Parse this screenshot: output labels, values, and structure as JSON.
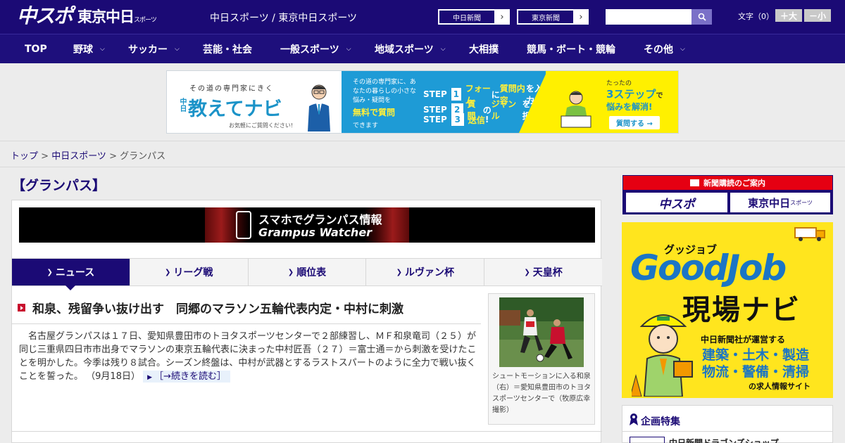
{
  "header": {
    "logo_chusupo": "中スポ",
    "logo_tokyo": "東京中日",
    "logo_tokyo_small": "スポーツ",
    "site_title": "中日スポーツ / 東京中日スポーツ",
    "ext_links": [
      {
        "label": "中日新聞"
      },
      {
        "label": "東京新聞"
      }
    ],
    "search_placeholder": "",
    "font_size_label": "文字（0）",
    "font_larger": "＋大",
    "font_smaller": "－小"
  },
  "nav": {
    "items": [
      {
        "label": "TOP",
        "dropdown": false
      },
      {
        "label": "野球",
        "dropdown": true
      },
      {
        "label": "サッカー",
        "dropdown": true
      },
      {
        "label": "芸能・社会",
        "dropdown": false
      },
      {
        "label": "一般スポーツ",
        "dropdown": true
      },
      {
        "label": "地域スポーツ",
        "dropdown": true
      },
      {
        "label": "大相撲",
        "dropdown": false
      },
      {
        "label": "競馬・ボート・競輪",
        "dropdown": false
      },
      {
        "label": "その他",
        "dropdown": true
      }
    ]
  },
  "ad_banner": {
    "tagline": "その道の専門家にきく",
    "brand_small": "中日",
    "brand": "教えてナビ",
    "note": "お気軽にご質問ください!",
    "mid_text": "その道の専門家に、あなたの暮らしの小さな悩み・疑問を",
    "mid_highlight": "無料で質問",
    "mid_tail": "できます",
    "steps": [
      {
        "label": "STEP",
        "num": "1",
        "text_a": "フォーム",
        "text_b": "に",
        "text_c": "質問内容",
        "text_d": "を入力"
      },
      {
        "label": "STEP",
        "num": "2",
        "text_a": "質問",
        "text_b": "の",
        "text_c": "ジャンル",
        "text_d": "を選択"
      },
      {
        "label": "STEP",
        "num": "3",
        "text_a": "送信",
        "text_b": "!",
        "text_c": "",
        "text_d": ""
      }
    ],
    "right_small": "たったの",
    "right_big": "3ステップ",
    "right_big_tail": "で",
    "right_solve": "悩みを解消!",
    "right_cta": "質問する →"
  },
  "breadcrumb": {
    "home": "トップ",
    "sep1": " > ",
    "section": "中日スポーツ",
    "sep2": " > ",
    "current": "グランパス"
  },
  "page": {
    "title": "【グランパス】"
  },
  "promo": {
    "line1": "スマホでグランパス情報",
    "line2": "Grampus Watcher"
  },
  "tabs": [
    {
      "label": "ニュース",
      "active": true
    },
    {
      "label": "リーグ戦",
      "active": false
    },
    {
      "label": "順位表",
      "active": false
    },
    {
      "label": "ルヴァン杯",
      "active": false
    },
    {
      "label": "天皇杯",
      "active": false
    }
  ],
  "article": {
    "headline": "和泉、残留争い抜け出す　同郷のマラソン五輪代表内定・中村に刺激",
    "body": "名古屋グランパスは１７日、愛知県豊田市のトヨタスポーツセンターで２部練習し、ＭＦ和泉竜司（２５）が同じ三重県四日市市出身でマラソンの東京五輪代表に決まった中村匠吾（２７）＝富士通＝から刺激を受けたことを明かした。今季は残り８試合。シーズン終盤は、中村が武器とするラストスパートのように全力で戦い抜くことを誓った。",
    "date": "（9月18日）",
    "read_more": "［→続きを読む］",
    "photo_caption": "シュートモーションに入る和泉（右）＝愛知県豊田市のトヨタスポーツセンターで（牧原広幸撮影）"
  },
  "sidebar": {
    "subscribe_head": "新聞購読のご案内",
    "subscribe_logo1": "中スポ",
    "subscribe_logo2": "東京中日",
    "subscribe_logo2_small": "スポーツ",
    "gj_small": "グッジョブ",
    "gj_big": "GoodJob",
    "gj_navi": "現場ナビ",
    "gj_l1": "中日新聞社が運営する",
    "gj_l2": "建築・土木・製造",
    "gj_l3": "物流・警備・清掃",
    "gj_l4": "の求人情報サイト",
    "feature_title": "企画特集",
    "feature_item": "中日新聞ドラゴンズショップ"
  },
  "colors": {
    "brand_navy": "#1b0a75",
    "accent_red": "#c8102e",
    "ad_blue": "#1e9bd6",
    "ad_yellow": "#fff000"
  }
}
